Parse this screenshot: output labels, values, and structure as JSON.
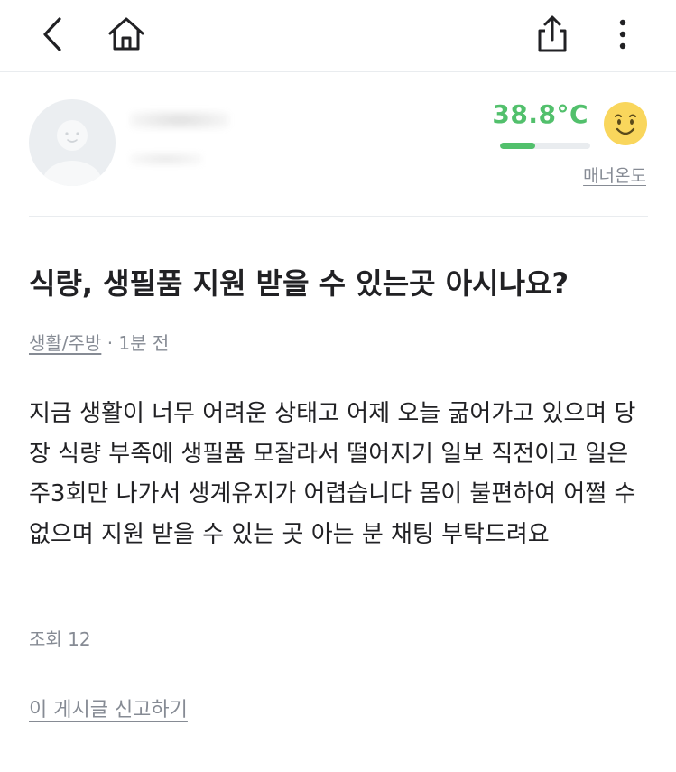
{
  "toolbar": {
    "back_icon": "chevron-left-icon",
    "home_icon": "home-icon",
    "share_icon": "share-icon",
    "more_icon": "more-vertical-icon"
  },
  "profile": {
    "avatar_icon": "default-avatar-icon",
    "temperature": "38.8°C",
    "temperature_level": 0.388,
    "temperature_color": "#52c06c",
    "face_icon": "smiling-face-icon",
    "manner_label": "매너온도"
  },
  "post": {
    "title": "식량, 생필품 지원 받을 수 있는곳 아시나요?",
    "category": "생활/주방",
    "separator": " · ",
    "time": "1분 전",
    "body": "지금 생활이 너무 어려운 상태고 어제 오늘 굶어가고 있으며 당장 식량 부족에 생필품 모잘라서 떨어지기 일보 직전이고 일은 주3회만 나가서 생계유지가 어렵습니다 몸이 불편하여 어쩔 수 없으며 지원 받을 수 있는 곳 아는 분 채팅 부탁드려요",
    "views_label": "조회 12",
    "report_label": "이 게시글 신고하기"
  }
}
